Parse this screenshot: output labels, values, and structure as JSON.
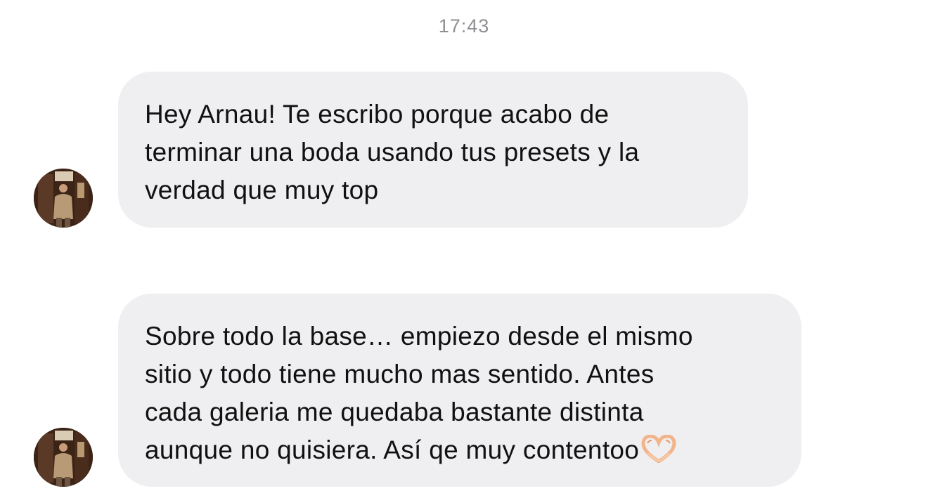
{
  "thread": {
    "timestamp": "17:43",
    "messages": [
      {
        "sender": "contact",
        "lines": [
          "Hey Arnau! Te escribo porque acabo de",
          "terminar una boda usando tus presets y la",
          "verdad que muy top"
        ]
      },
      {
        "sender": "contact",
        "lines": [
          "Sobre todo la base… empiezo desde el mismo",
          "sitio y todo tiene mucho mas sentido. Antes",
          "cada galeria me quedaba bastante distinta",
          "aunque no quisiera. Así qe muy contentoo"
        ],
        "trailing_emoji": "heart-hands-emoji"
      }
    ]
  },
  "colors": {
    "bubble_background": "#efeff1",
    "message_text": "#111111",
    "timestamp_text": "#8e8e93",
    "page_background": "#ffffff"
  }
}
